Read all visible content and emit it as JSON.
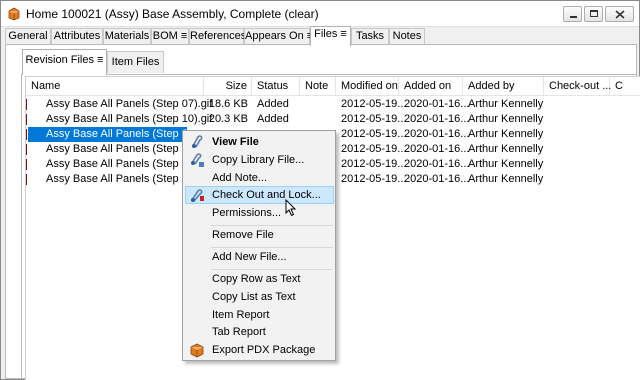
{
  "window": {
    "title": "Home 100021 (Assy) Base Assembly, Complete (clear)"
  },
  "tabs": [
    "General",
    "Attributes",
    "Materials",
    "BOM ≡",
    "References",
    "Appears On ≡",
    "Files ≡",
    "Tasks",
    "Notes"
  ],
  "active_tab": "Files ≡",
  "subtabs": [
    "Revision Files ≡",
    "Item Files"
  ],
  "active_subtab": "Revision Files ≡",
  "columns": [
    "Name",
    "Size",
    "Status",
    "Note",
    "Modified on",
    "Added on",
    "Added by",
    "Check-out ...",
    "C"
  ],
  "rows": [
    {
      "name": "Assy Base All Panels (Step 07).gif",
      "size": "18.6 KB",
      "status": "Added",
      "note": "",
      "modified": "2012-05-19...",
      "added": "2020-01-16...",
      "added_by": "Arthur Kennelly"
    },
    {
      "name": "Assy Base All Panels (Step 10).gif",
      "size": "20.3 KB",
      "status": "Added",
      "note": "",
      "modified": "2012-05-19...",
      "added": "2020-01-16...",
      "added_by": "Arthur Kennelly"
    },
    {
      "name": "Assy Base All Panels (Step 08).gif",
      "size": "",
      "status": "",
      "note": "",
      "modified": "2012-05-19...",
      "added": "2020-01-16...",
      "added_by": "Arthur Kennelly"
    },
    {
      "name": "Assy Base All Panels (Step 11).gif",
      "size": "",
      "status": "",
      "note": "",
      "modified": "2012-05-19...",
      "added": "2020-01-16...",
      "added_by": "Arthur Kennelly"
    },
    {
      "name": "Assy Base All Panels (Step 09).gif",
      "size": "",
      "status": "",
      "note": "",
      "modified": "2012-05-19...",
      "added": "2020-01-16...",
      "added_by": "Arthur Kennelly"
    },
    {
      "name": "Assy Base All Panels (Step 12).gif",
      "size": "",
      "status": "",
      "note": "",
      "modified": "2012-05-19...",
      "added": "2020-01-16...",
      "added_by": "Arthur Kennelly"
    }
  ],
  "selected_row": 2,
  "context_menu": {
    "items": [
      {
        "label": "View File",
        "icon": "view-file-icon"
      },
      {
        "label": "Copy Library File...",
        "icon": "copy-library-icon"
      },
      {
        "label": "Add Note...",
        "icon": ""
      },
      {
        "label": "Check Out and Lock...",
        "icon": "check-out-lock-icon"
      },
      {
        "label": "Permissions...",
        "icon": ""
      },
      {
        "label": "Remove File",
        "icon": ""
      },
      {
        "label": "Add New File...",
        "icon": ""
      },
      {
        "label": "Copy Row as Text",
        "icon": ""
      },
      {
        "label": "Copy List as Text",
        "icon": ""
      },
      {
        "label": "Item Report",
        "icon": ""
      },
      {
        "label": "Tab Report",
        "icon": ""
      },
      {
        "label": "Export PDX Package",
        "icon": "package-icon"
      }
    ],
    "hovered": "Check Out and Lock..."
  },
  "colors": {
    "selection": "#0078d7",
    "menu_hover": "#cce8ff",
    "menu_hover_border": "#99d1ff"
  }
}
